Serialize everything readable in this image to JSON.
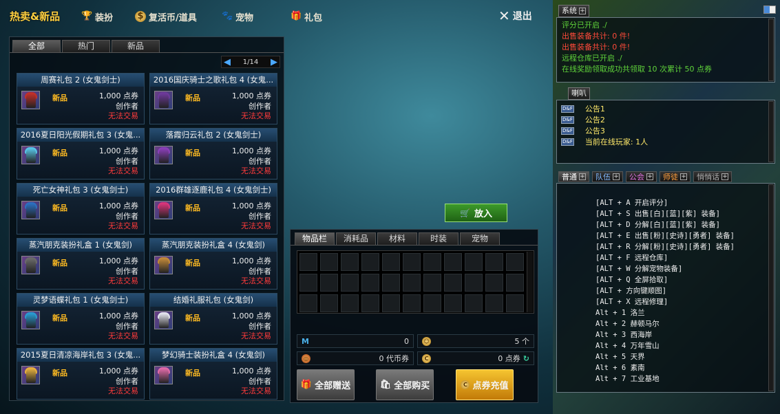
{
  "topbar": {
    "logo_part1": "热卖",
    "logo_part2": "&新品",
    "nav": [
      {
        "label": "装扮",
        "icon": "trophy-icon"
      },
      {
        "label": "复活币/道具",
        "icon": "coin-icon"
      },
      {
        "label": "宠物",
        "icon": "paw-icon"
      },
      {
        "label": "礼包",
        "icon": "gift-icon"
      }
    ],
    "exit_label": "退出"
  },
  "shop": {
    "tabs": [
      "全部",
      "热门",
      "新品"
    ],
    "active_tab": 0,
    "page": "1/14",
    "items": [
      {
        "title": "周赛礼包 2 (女鬼剑士)",
        "badge": "新品",
        "price": "1,000 点券",
        "creator": "创作者",
        "trade": "无法交易",
        "color": "#c0302a"
      },
      {
        "title": "2016国庆骑士之歌礼包 4 (女鬼...",
        "badge": "新品",
        "price": "1,000 点券",
        "creator": "创作者",
        "trade": "无法交易",
        "color": "#6d3a9a"
      },
      {
        "title": "2016夏日阳光假期礼包 3 (女鬼...",
        "badge": "新品",
        "price": "1,000 点券",
        "creator": "创作者",
        "trade": "无法交易",
        "color": "#58c4e6"
      },
      {
        "title": "落霞归云礼包 2 (女鬼剑士)",
        "badge": "新品",
        "price": "1,000 点券",
        "creator": "创作者",
        "trade": "无法交易",
        "color": "#8a3fb8"
      },
      {
        "title": "死亡女神礼包 3 (女鬼剑士)",
        "badge": "新品",
        "price": "1,000 点券",
        "creator": "创作者",
        "trade": "无法交易",
        "color": "#2c6fbf"
      },
      {
        "title": "2016群雄逐鹿礼包 4 (女鬼剑士)",
        "badge": "新品",
        "price": "1,000 点券",
        "creator": "创作者",
        "trade": "无法交易",
        "color": "#d8357a"
      },
      {
        "title": "蒸汽朋克装扮礼盒 1 (女鬼剑)",
        "badge": "新品",
        "price": "1,000 点券",
        "creator": "创作者",
        "trade": "无法交易",
        "color": "#6a6a6a"
      },
      {
        "title": "蒸汽朋克装扮礼盒 4 (女鬼剑)",
        "badge": "新品",
        "price": "1,000 点券",
        "creator": "创作者",
        "trade": "无法交易",
        "color": "#c0883a"
      },
      {
        "title": "灵梦语蝶礼包 1 (女鬼剑士)",
        "badge": "新品",
        "price": "1,000 点券",
        "creator": "创作者",
        "trade": "无法交易",
        "color": "#2a9ad0"
      },
      {
        "title": "结婚礼服礼包 (女鬼剑)",
        "badge": "新品",
        "price": "1,000 点券",
        "creator": "创作者",
        "trade": "无法交易",
        "color": "#e2e2ec"
      },
      {
        "title": "2015夏日清凉海岸礼包 3 (女鬼...",
        "badge": "新品",
        "price": "1,000 点券",
        "creator": "创作者",
        "trade": "无法交易",
        "color": "#e6b040"
      },
      {
        "title": "梦幻骑士装扮礼盒 4 (女鬼剑)",
        "badge": "新品",
        "price": "1,000 点券",
        "creator": "创作者",
        "trade": "无法交易",
        "color": "#e06aa8"
      }
    ]
  },
  "put_in_label": "放入",
  "inventory": {
    "tabs": [
      "物品栏",
      "消耗品",
      "材料",
      "时装",
      "宠物"
    ],
    "active_tab": 0,
    "mileage_value": "0",
    "count_value": "5 个",
    "daibi_value": "0 代币券",
    "dianquan_value": "0 点券",
    "buttons": {
      "gift_all": "全部赠送",
      "buy_all": "全部购买",
      "recharge": "点券充值"
    }
  },
  "system": {
    "title": "系统",
    "lines": [
      {
        "text": "评分已开启 ./",
        "color": "green"
      },
      {
        "text": "出售装备共计: 0 件!",
        "color": "red"
      },
      {
        "text": "出售装备共计: 0 件!",
        "color": "red"
      },
      {
        "text": "远程仓库已开启 ./",
        "color": "green"
      },
      {
        "text": "在线奖励领取成功共领取 10 次累计 50 点券",
        "color": "green"
      }
    ]
  },
  "horn": {
    "title": "喇叭",
    "tag": "D&F",
    "lines": [
      "公告1",
      "公告2",
      "公告3",
      "当前在线玩家: 1人"
    ]
  },
  "chat": {
    "tabs": [
      {
        "label": "普通",
        "color": "#ffffff"
      },
      {
        "label": "队伍",
        "color": "#7fb8ff"
      },
      {
        "label": "公会",
        "color": "#e070e0"
      },
      {
        "label": "师徒",
        "color": "#ff9d3a"
      },
      {
        "label": "悄悄话",
        "color": "#b0b0b0"
      }
    ],
    "active_tab": 0,
    "lines": [
      "[ALT + A   开启评分]",
      "[ALT + S   出售[白][蓝][紫] 装备]",
      "[ALT + D   分解[白][蓝][紫] 装备]",
      "[ALT + E   出售[粉][史诗][勇者] 装备]",
      "[ALT + R   分解[粉][史诗][勇者] 装备]",
      "[ALT + F   远程仓库]",
      "[ALT + W   分解宠物装备]",
      "[ALT + Q   全屏拾取]",
      "[ALT + 方向键顺图]",
      "[ALT + X 远程修理]",
      "Alt + 1   洛兰",
      "Alt + 2   赫顿马尔",
      "Alt + 3   西海岸",
      "Alt + 4   万年雪山",
      "Alt + 5   天界",
      "Alt + 6   素南",
      "Alt + 7   工业基地"
    ]
  }
}
